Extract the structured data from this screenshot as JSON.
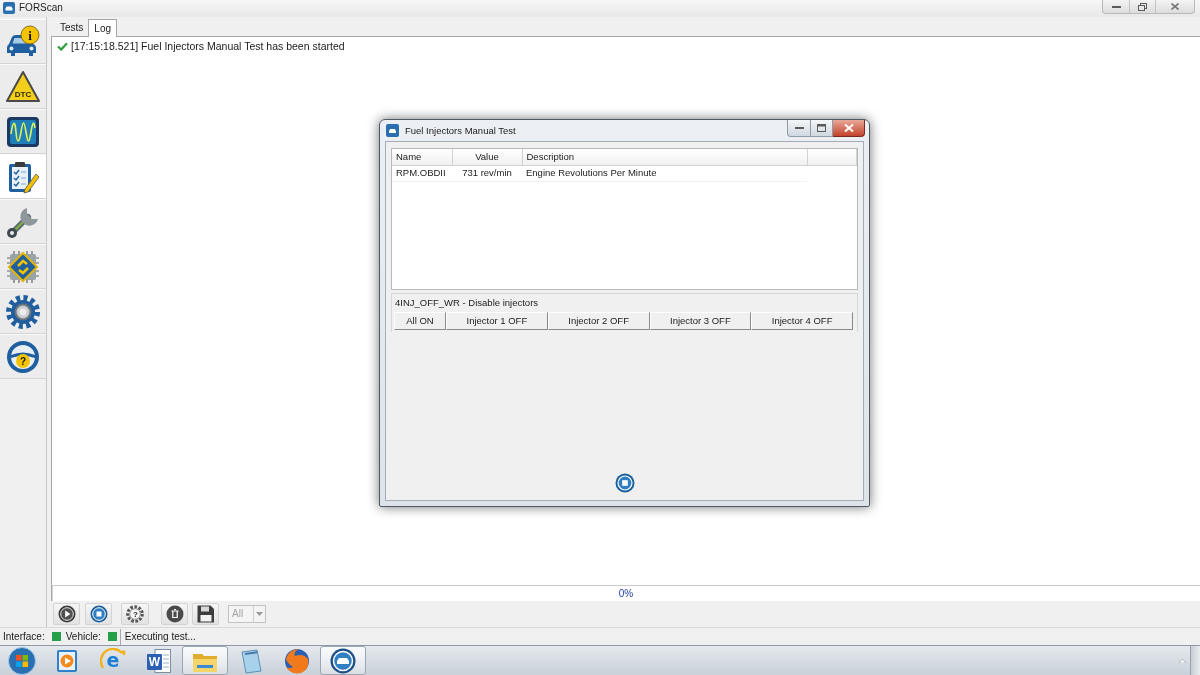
{
  "window": {
    "title": "FORScan"
  },
  "sidebar": {
    "items": [
      {
        "kind": "vehicle-info",
        "label": "i",
        "selected": false
      },
      {
        "kind": "dtc",
        "label": "DTC",
        "selected": false
      },
      {
        "kind": "oscilloscope",
        "selected": false
      },
      {
        "kind": "checklist",
        "selected": true
      },
      {
        "kind": "wrench",
        "selected": false
      },
      {
        "kind": "chip",
        "selected": false
      },
      {
        "kind": "gear",
        "selected": false
      },
      {
        "kind": "help",
        "label": "?",
        "selected": false
      }
    ]
  },
  "tabs": [
    {
      "label": "Tests",
      "selected": false
    },
    {
      "label": "Log",
      "selected": true
    }
  ],
  "log": [
    {
      "kind": "success",
      "text": "[17:15:18.521] Fuel Injectors Manual Test has been started"
    }
  ],
  "progress": {
    "level": 0,
    "reading": "0%"
  },
  "toolbar": {
    "buttons": [
      {
        "kind": "play"
      },
      {
        "kind": "stop"
      },
      {
        "kind": "help",
        "label": "?"
      },
      {
        "kind": "clear"
      },
      {
        "kind": "save"
      }
    ],
    "filter": {
      "value": "All",
      "disabled": true
    }
  },
  "status_bar": {
    "indicators": [
      {
        "label": "Interface:",
        "color": "#23a048"
      },
      {
        "label": "Vehicle:",
        "color": "#23a048"
      }
    ],
    "message": "Executing test..."
  },
  "dialog": {
    "title": "Fuel Injectors Manual Test",
    "table": {
      "columns": [
        "Name",
        "Value",
        "Description"
      ],
      "rows": [
        [
          "RPM.OBDII",
          "731 rev/min",
          "Engine Revolutions Per Minute"
        ]
      ]
    },
    "group": {
      "title": "4INJ_OFF_WR - Disable injectors",
      "buttons": [
        "All ON",
        "Injector 1 OFF",
        "Injector 2 OFF",
        "Injector 3 OFF",
        "Injector 4 OFF"
      ]
    }
  },
  "taskbar": {
    "items": [
      {
        "kind": "media-player",
        "running": false
      },
      {
        "kind": "browser",
        "label": "e",
        "running": false
      },
      {
        "kind": "word-processor",
        "label": "W",
        "running": false
      },
      {
        "kind": "file-manager",
        "running": true
      },
      {
        "kind": "notepad",
        "running": false
      },
      {
        "kind": "web-browser",
        "running": false
      },
      {
        "kind": "scan-tool",
        "running": true
      }
    ]
  }
}
